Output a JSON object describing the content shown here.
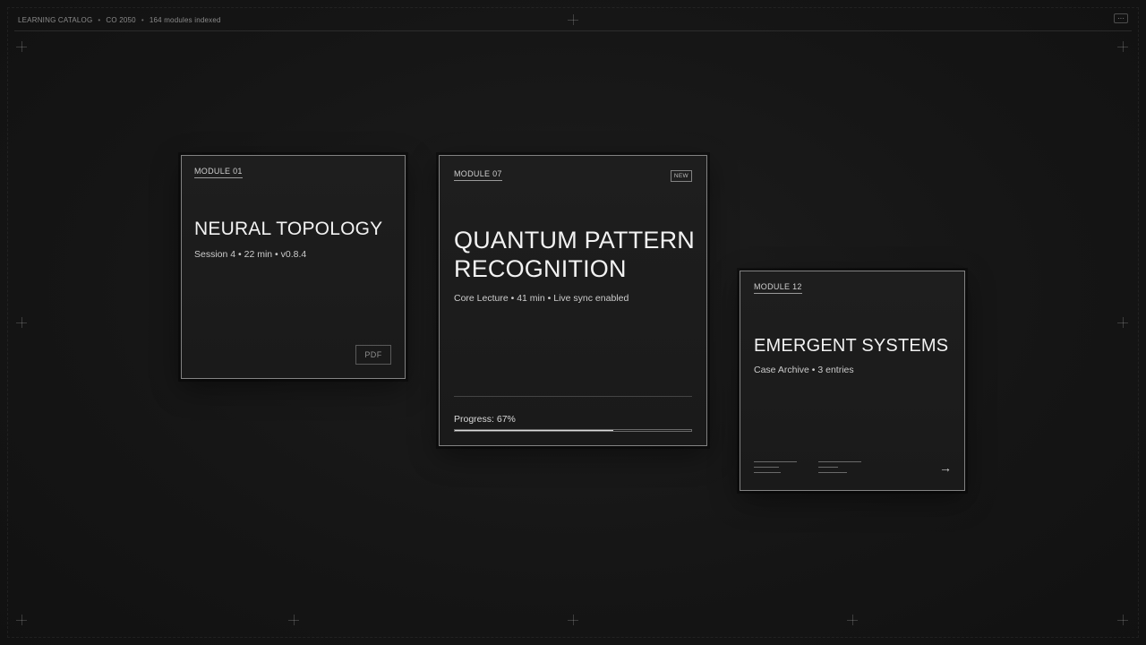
{
  "topbar": {
    "catalog": "LEARNING CATALOG",
    "year": "CO 2050",
    "count": "164 modules indexed",
    "separator": "•",
    "menu_glyph": "···"
  },
  "cards": [
    {
      "tag": "MODULE 01",
      "title": "NEURAL TOPOLOGY",
      "meta": "Session 4 • 22 min • v0.8.4",
      "action": "PDF"
    },
    {
      "tag": "MODULE 07",
      "badge": "NEW",
      "title": "QUANTUM PATTERN RECOGNITION",
      "meta": "Core Lecture • 41 min • Live sync enabled",
      "progress_label": "Progress: 67%",
      "progress": 0.67
    },
    {
      "tag": "MODULE 12",
      "title": "EMERGENT SYSTEMS",
      "meta": "Case Archive • 3 entries",
      "arrow_icon": "arrow-right-icon"
    }
  ],
  "colors": {
    "background": "#161616",
    "card": "#1c1c1c",
    "border": "#8c8c8c",
    "text": "#f2f2f2"
  }
}
